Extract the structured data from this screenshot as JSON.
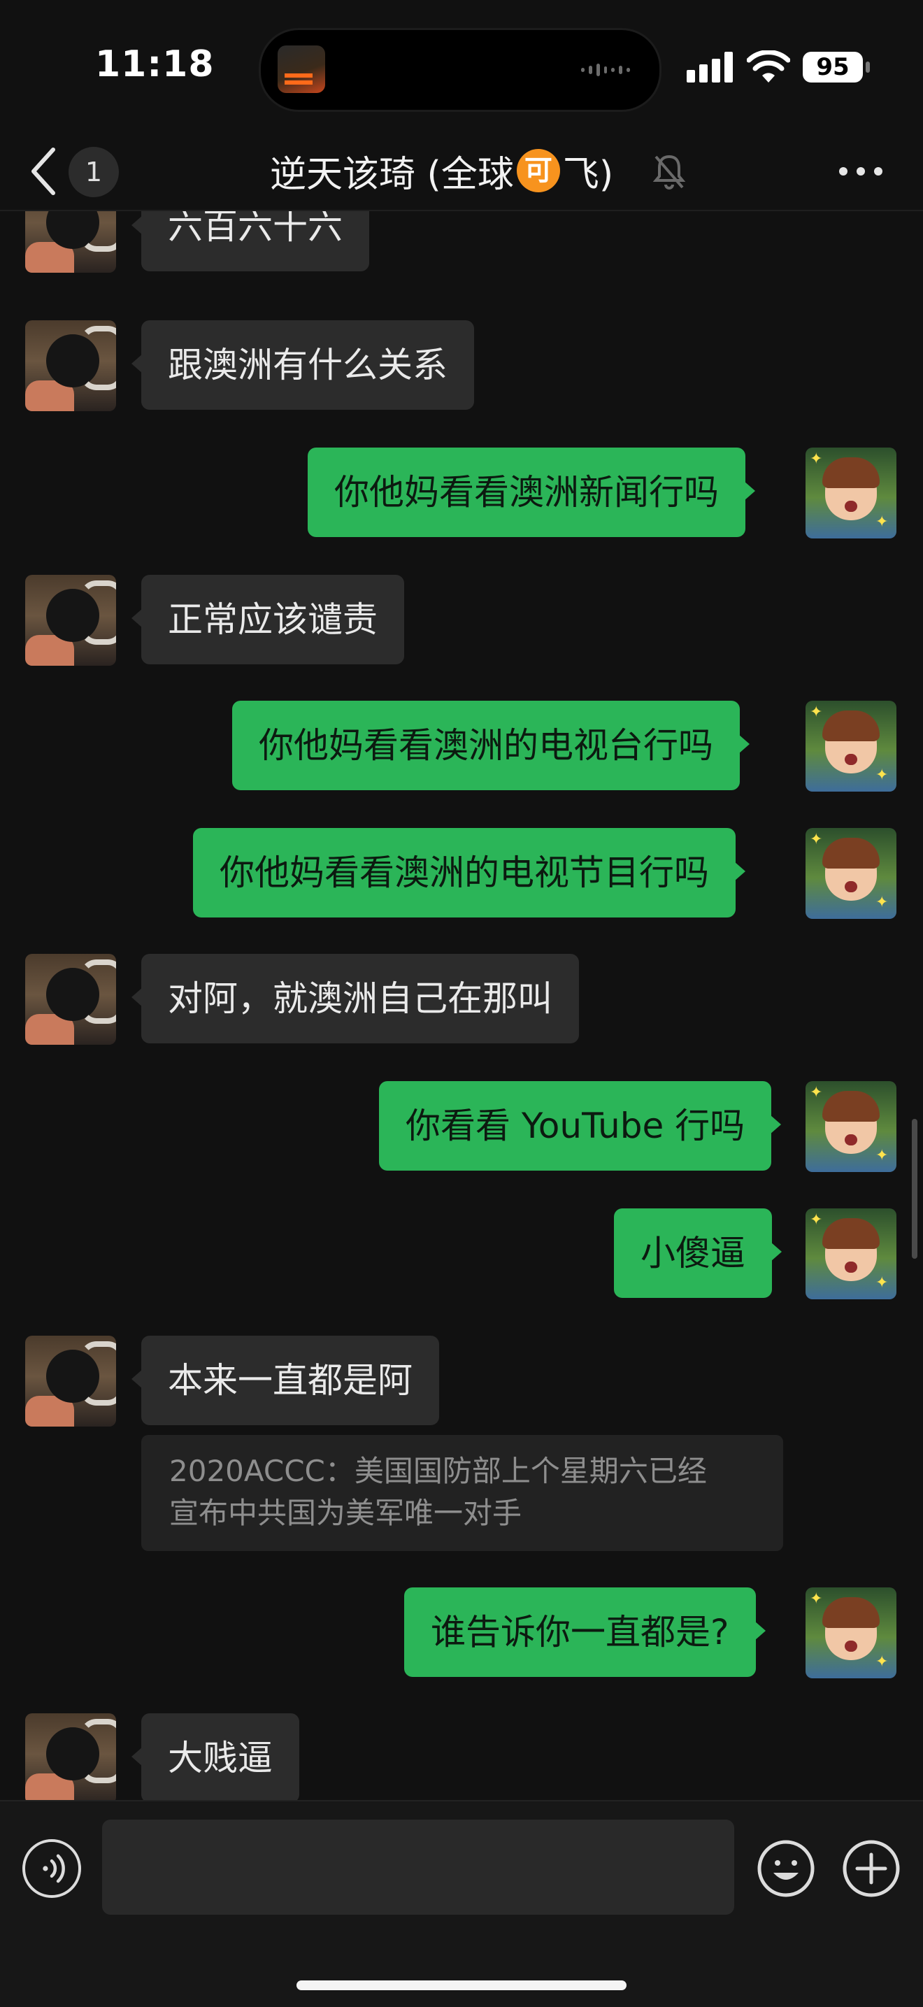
{
  "status_bar": {
    "time": "11:18",
    "battery": "95"
  },
  "header": {
    "unread_count": "1",
    "title_prefix": "逆天该琦 (全球",
    "title_emoji_char": "可",
    "title_suffix": "飞)"
  },
  "messages": [
    {
      "side": "left",
      "text": "六百六十六"
    },
    {
      "side": "left",
      "text": "跟澳洲有什么关系"
    },
    {
      "side": "right",
      "text": "你他妈看看澳洲新闻行吗"
    },
    {
      "side": "left",
      "text": "正常应该谴责"
    },
    {
      "side": "right",
      "text": "你他妈看看澳洲的电视台行吗"
    },
    {
      "side": "right",
      "text": "你他妈看看澳洲的电视节目行吗"
    },
    {
      "side": "left",
      "text": "对阿，就澳洲自己在那叫"
    },
    {
      "side": "right",
      "text": "你看看 YouTube 行吗"
    },
    {
      "side": "right",
      "text": "小傻逼"
    },
    {
      "side": "left",
      "text": "本来一直都是阿",
      "quote": [
        "2020ACCC：美国国防部上个星期六已经",
        "宣布中共国为美军唯一对手"
      ]
    },
    {
      "side": "right",
      "text": "谁告诉你一直都是?"
    },
    {
      "side": "left",
      "text": "大贱逼"
    }
  ],
  "input_bar": {
    "placeholder": ""
  },
  "colors": {
    "bubble_me": "#2bb558",
    "bubble_other": "#2c2c2c",
    "background": "#111111"
  }
}
